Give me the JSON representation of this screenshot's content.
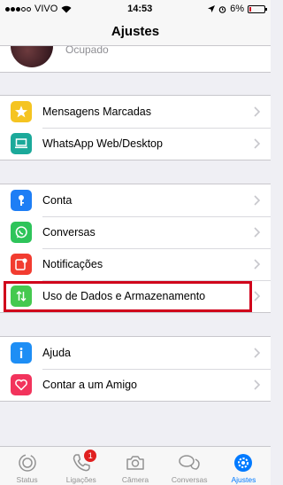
{
  "status_bar": {
    "carrier": "VIVO",
    "time": "14:53",
    "battery": "6%"
  },
  "nav": {
    "title": "Ajustes"
  },
  "profile": {
    "status": "Ocupado"
  },
  "sections": [
    {
      "items": [
        {
          "label": "Mensagens Marcadas",
          "icon": "star-icon",
          "color": "#f5c421"
        },
        {
          "label": "WhatsApp Web/Desktop",
          "icon": "laptop-icon",
          "color": "#1ba99a"
        }
      ]
    },
    {
      "items": [
        {
          "label": "Conta",
          "icon": "key-icon",
          "color": "#1e7ef5"
        },
        {
          "label": "Conversas",
          "icon": "whatsapp-icon",
          "color": "#2ec45a"
        },
        {
          "label": "Notificações",
          "icon": "notification-icon",
          "color": "#f23c30"
        },
        {
          "label": "Uso de Dados e Armazenamento",
          "icon": "data-arrows-icon",
          "color": "#45c94f"
        }
      ]
    },
    {
      "items": [
        {
          "label": "Ajuda",
          "icon": "info-icon",
          "color": "#1e8ef5"
        },
        {
          "label": "Contar a um Amigo",
          "icon": "heart-icon",
          "color": "#f2335c"
        }
      ]
    }
  ],
  "tab_bar": {
    "tabs": [
      {
        "label": "Status"
      },
      {
        "label": "Ligações",
        "badge": "1"
      },
      {
        "label": "Câmera"
      },
      {
        "label": "Conversas"
      },
      {
        "label": "Ajustes"
      }
    ]
  }
}
